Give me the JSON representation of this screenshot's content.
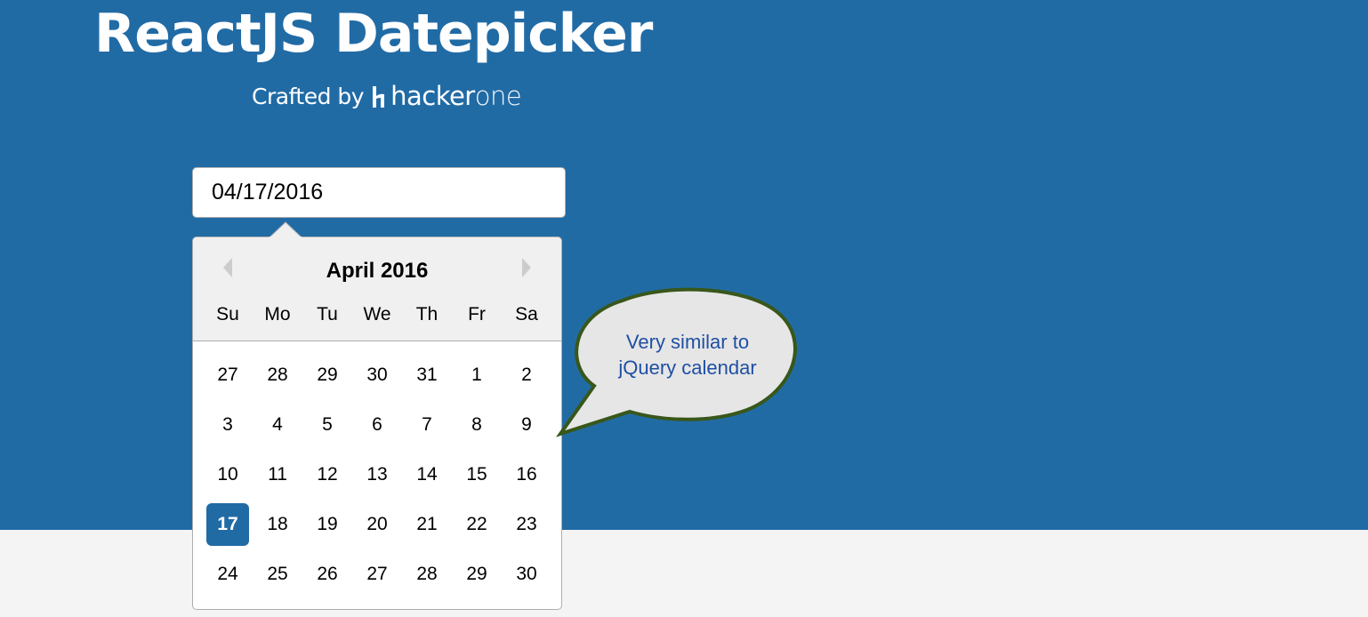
{
  "header": {
    "title": "ReactJS Datepicker",
    "crafted_by": "Crafted by",
    "brand_part1": "hacker",
    "brand_part2": "one"
  },
  "date_input": {
    "value": "04/17/2016"
  },
  "calendar": {
    "month_label": "April 2016",
    "weekdays": [
      "Su",
      "Mo",
      "Tu",
      "We",
      "Th",
      "Fr",
      "Sa"
    ],
    "weeks": [
      [
        "27",
        "28",
        "29",
        "30",
        "31",
        "1",
        "2"
      ],
      [
        "3",
        "4",
        "5",
        "6",
        "7",
        "8",
        "9"
      ],
      [
        "10",
        "11",
        "12",
        "13",
        "14",
        "15",
        "16"
      ],
      [
        "17",
        "18",
        "19",
        "20",
        "21",
        "22",
        "23"
      ],
      [
        "24",
        "25",
        "26",
        "27",
        "28",
        "29",
        "30"
      ]
    ],
    "selected_day": "17"
  },
  "callout": {
    "line1": "Very similar to",
    "line2": "jQuery calendar"
  },
  "colors": {
    "hero_bg": "#216ba5",
    "page_bg": "#f4f4f4",
    "selected_day_bg": "#216ba5",
    "callout_fill": "#e6e6e6",
    "callout_border": "#38571a",
    "callout_text": "#1f4fa3"
  }
}
